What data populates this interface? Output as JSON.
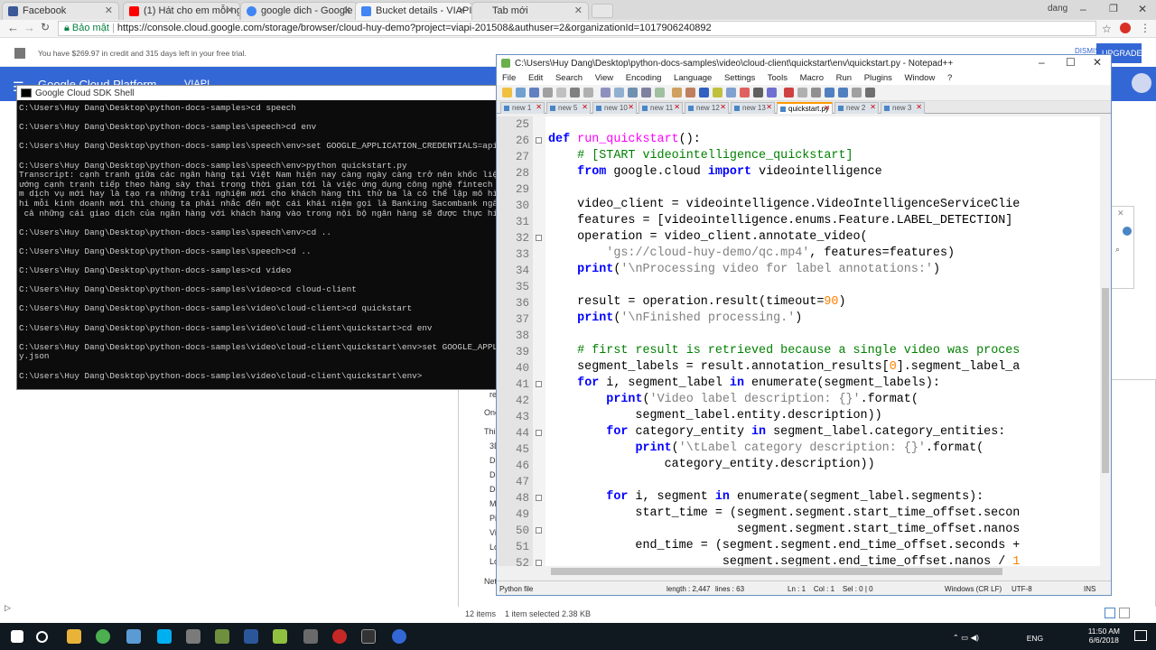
{
  "browser": {
    "tabs": [
      {
        "label": "Facebook",
        "color": "#3b5998"
      },
      {
        "label": "(1) Hát cho em mỗi ngày",
        "color": "#ff0000"
      },
      {
        "label": "google dich - Google Se",
        "color": "#4285f4"
      },
      {
        "label": "Bucket details - VIAPI",
        "color": "#4285f4"
      },
      {
        "label": "Tab mới",
        "color": "#ffffff"
      }
    ],
    "user": "dang",
    "secure_label": "Bảo mật",
    "url": "https://console.cloud.google.com/storage/browser/cloud-huy-demo?project=viapi-201508&authuser=2&organizationId=1017906240892"
  },
  "gcp": {
    "credit_text": "You have $269.97 in credit and 315 days left in your free trial.",
    "title": "Google Cloud Platform",
    "project": "VIAPI",
    "upgrade_label": "UPGRADE",
    "dismiss_label": "DISMISS"
  },
  "cmd": {
    "title": "Google Cloud SDK Shell",
    "lines": [
      "C:\\Users\\Huy Dang\\Desktop\\python-docs-samples>cd speech",
      "",
      "C:\\Users\\Huy Dang\\Desktop\\python-docs-samples\\speech>cd env",
      "",
      "C:\\Users\\Huy Dang\\Desktop\\python-docs-samples\\speech\\env>set GOOGLE_APPLICATION_CREDENTIALS=apikey.j",
      "",
      "C:\\Users\\Huy Dang\\Desktop\\python-docs-samples\\speech\\env>python quickstart.py",
      "Transcript: cạnh tranh giữa các ngân hàng tại Việt Nam hiện nay càng ngày càng trở nên khốc liệt và",
      "ướng cạnh tranh tiếp theo hàng sày thai trong thời gian tới là việc ứng dụng công nghệ fintech để ph",
      "m dịch vụ mới hay là tạo ra những trải nghiệm mới cho khách hàng thì thử ba là có thể lập mô hình k",
      "hi mỗi kinh doanh mới thì chúng ta phải nhắc đến một cái khái niệm gọi là Banking Sacombank ngân hàn",
      " cả những cái giao dịch của ngân hàng với khách hàng vào trong nội bộ ngân hàng sẽ được thực hiện t",
      "",
      "C:\\Users\\Huy Dang\\Desktop\\python-docs-samples\\speech\\env>cd ..",
      "",
      "C:\\Users\\Huy Dang\\Desktop\\python-docs-samples\\speech>cd ..",
      "",
      "C:\\Users\\Huy Dang\\Desktop\\python-docs-samples>cd video",
      "",
      "C:\\Users\\Huy Dang\\Desktop\\python-docs-samples\\video>cd cloud-client",
      "",
      "C:\\Users\\Huy Dang\\Desktop\\python-docs-samples\\video\\cloud-client>cd quickstart",
      "",
      "C:\\Users\\Huy Dang\\Desktop\\python-docs-samples\\video\\cloud-client\\quickstart>cd env",
      "",
      "C:\\Users\\Huy Dang\\Desktop\\python-docs-samples\\video\\cloud-client\\quickstart\\env>set GOOGLE_APPLICATI",
      "y.json",
      "",
      "C:\\Users\\Huy Dang\\Desktop\\python-docs-samples\\video\\cloud-client\\quickstart\\env>"
    ]
  },
  "npp": {
    "title": "C:\\Users\\Huy Dang\\Desktop\\python-docs-samples\\video\\cloud-client\\quickstart\\env\\quickstart.py - Notepad++",
    "menu": [
      "File",
      "Edit",
      "Search",
      "View",
      "Encoding",
      "Language",
      "Settings",
      "Tools",
      "Macro",
      "Run",
      "Plugins",
      "Window",
      "?"
    ],
    "tabs": [
      "new 1",
      "new 5",
      "new 10",
      "new 11",
      "new 12",
      "new 13",
      "quickstart.py",
      "new 2",
      "new 3"
    ],
    "active_tab": "quickstart.py",
    "status": {
      "lang": "Python file",
      "length": "length : 2,447",
      "lines": "lines : 63",
      "pos": "Ln : 1    Col : 1    Sel : 0 | 0",
      "eol": "Windows (CR LF)",
      "enc": "UTF-8",
      "ins": "INS"
    },
    "line_numbers": [
      "25",
      "26",
      "27",
      "28",
      "29",
      "30",
      "31",
      "32",
      "33",
      "34",
      "35",
      "36",
      "37",
      "38",
      "39",
      "40",
      "41",
      "42",
      "43",
      "44",
      "45",
      "46",
      "47",
      "48",
      "49",
      "50",
      "51",
      "52"
    ]
  },
  "explorer": {
    "items": [
      "res",
      "One",
      "This",
      "3D",
      "De",
      "Do",
      "Do",
      "M",
      "Pi",
      "Vi",
      "Lo",
      "Lo",
      "Net"
    ],
    "status_items": "12 items",
    "status_selected": "1 item selected  2.38 KB"
  },
  "taskbar": {
    "time": "11:50 AM",
    "date": "6/6/2018",
    "lang": "ENG"
  }
}
